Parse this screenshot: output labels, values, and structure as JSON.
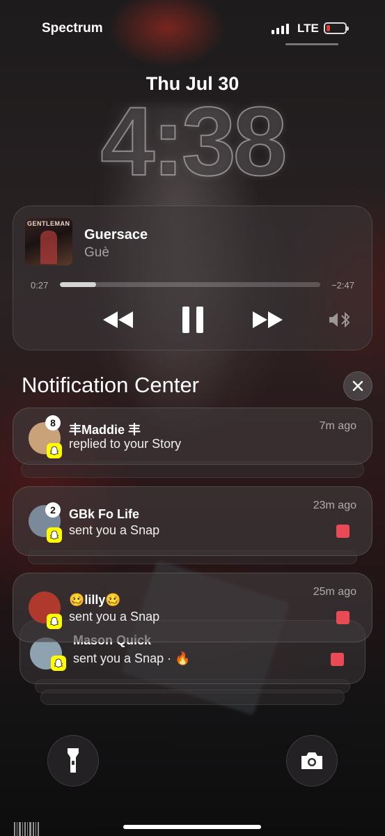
{
  "status_bar": {
    "carrier": "Spectrum",
    "network": "LTE",
    "signal_bars": 4,
    "battery_level": 0.1,
    "battery_color": "#e23b3b"
  },
  "lock_screen": {
    "date": "Thu Jul 30",
    "time": "4:38"
  },
  "now_playing": {
    "album_art_text": "GENTLEMAN",
    "title": "Guersace",
    "artist": "Guè",
    "elapsed": "0:27",
    "remaining": "−2:47",
    "progress": 0.14,
    "controls": {
      "rewind_icon": "rewind-icon",
      "pause_icon": "pause-icon",
      "forward_icon": "fast-forward-icon",
      "output_icon": "bluetooth-speaker-icon"
    }
  },
  "notification_center": {
    "title": "Notification Center",
    "clear_icon": "close-icon",
    "notifications": [
      {
        "app": "Snapchat",
        "sender": "丰Maddie 丰",
        "body": "replied to your Story",
        "time": "7m ago",
        "count": "8",
        "avatar_color": "#caa27a"
      },
      {
        "app": "Snapchat",
        "sender": "GBk Fo Life",
        "body": "sent you a Snap",
        "time": "23m ago",
        "count": "2",
        "avatar_color": "#7a8a9a",
        "snap_color": "#e94a55"
      },
      {
        "app": "Snapchat",
        "sender": "🥴lilly🥴",
        "body": "sent you a Snap",
        "time": "25m ago",
        "avatar_color": "#b0392e",
        "snap_color": "#e94a55"
      },
      {
        "app": "Snapchat",
        "sender": "Mason Quick",
        "body": "sent you a Snap · 🔥",
        "avatar_color": "#8fa2b0",
        "snap_color": "#e94a55"
      }
    ]
  },
  "quick_actions": {
    "flashlight_icon": "flashlight-icon",
    "camera_icon": "camera-icon"
  }
}
